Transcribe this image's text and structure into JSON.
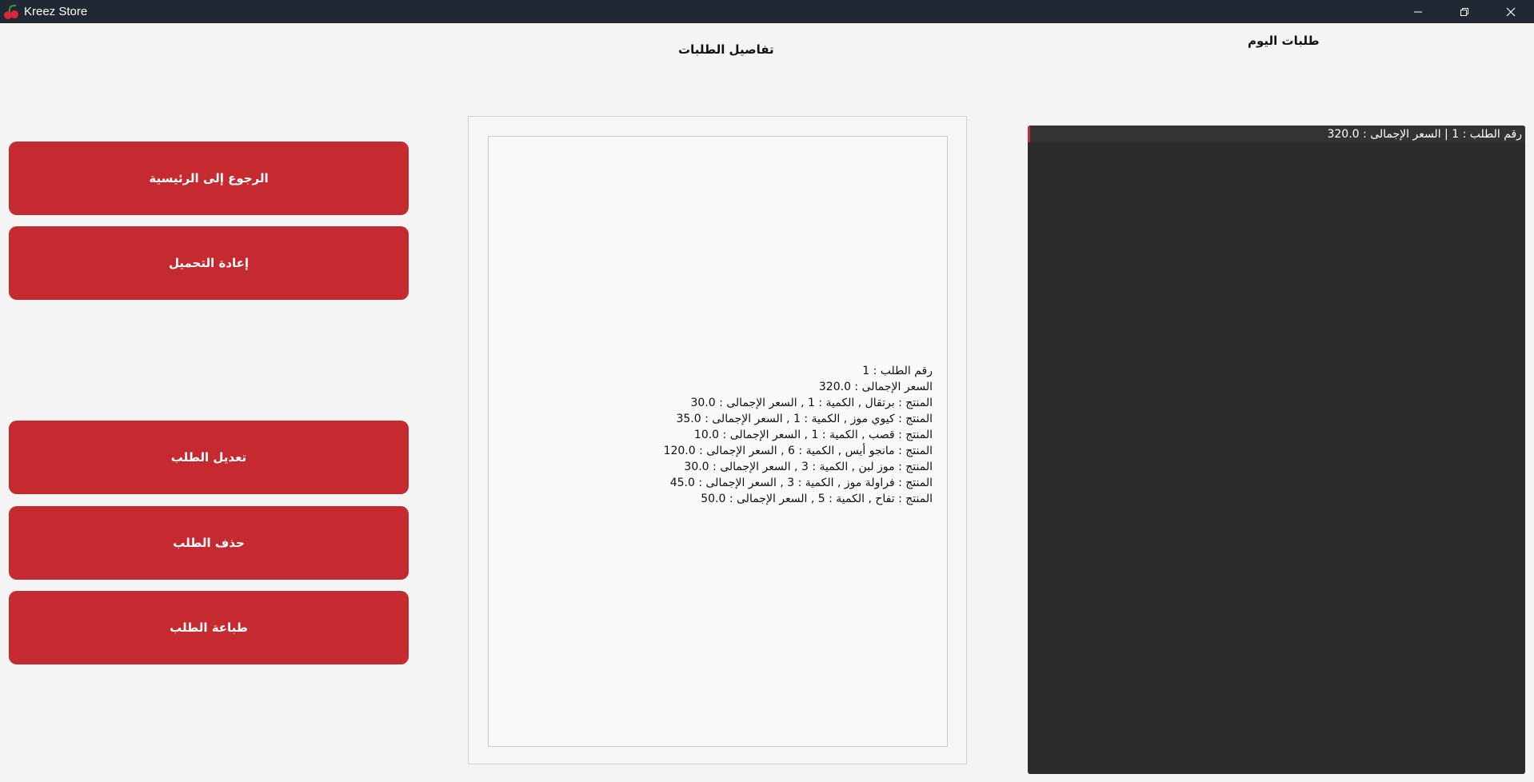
{
  "window": {
    "title": "Kreez Store",
    "controls": [
      "minimize-icon",
      "restore-icon",
      "close-icon"
    ]
  },
  "headings": {
    "details": "تفاصيل الطلبات",
    "today": "طلبات اليوم"
  },
  "buttons": {
    "home": "الرجوع إلى الرئيسية",
    "reload": "إعادة التحميل",
    "edit": "تعديل الطلب",
    "delete": "حذف الطلب",
    "print": "طباعة الطلب"
  },
  "details": {
    "lines": [
      "رقم الطلب : 1",
      "السعر الإجمالى : 320.0",
      "المنتج : برتقال , الكمية : 1 , السعر الإجمالى : 30.0",
      "المنتج : كيوي موز , الكمية : 1 , السعر الإجمالى : 35.0",
      "المنتج : قصب , الكمية : 1 , السعر الإجمالى : 10.0",
      "المنتج : مانجو أيس , الكمية : 6 , السعر الإجمالى : 120.0",
      "المنتج : موز لبن , الكمية : 3 , السعر الإجمالى : 30.0",
      "المنتج : فراولة موز , الكمية : 3 , السعر الإجمالى : 45.0",
      "المنتج : تفاح , الكمية : 5 , السعر الإجمالى : 50.0"
    ]
  },
  "orders": {
    "items": [
      "رقم الطلب : 1 | السعر الإجمالى : 320.0"
    ]
  },
  "colors": {
    "titlebar": "#202833",
    "accent": "#c62a31",
    "list_background": "#2b2b2b",
    "page_background": "#f4f4f4"
  }
}
